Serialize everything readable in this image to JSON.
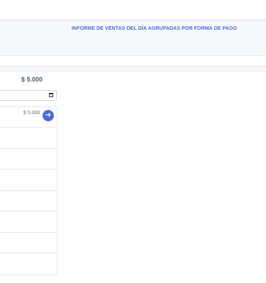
{
  "report": {
    "title": "INFORME DE VENTAS DEL DÍA AGRUPADAS POR FORMA DE PAGO"
  },
  "summary": {
    "total": "$ 5.000"
  },
  "date_filter": {
    "value": ""
  },
  "payments": [
    {
      "amount": "$ 5.000",
      "action_icon": "arrow-right-icon"
    },
    {
      "amount": ""
    },
    {
      "amount": ""
    },
    {
      "amount": ""
    },
    {
      "amount": ""
    },
    {
      "amount": ""
    },
    {
      "amount": ""
    },
    {
      "amount": ""
    }
  ],
  "colors": {
    "accent": "#4a6ddb",
    "text_muted": "#66708a",
    "border": "#e3e6ee"
  }
}
